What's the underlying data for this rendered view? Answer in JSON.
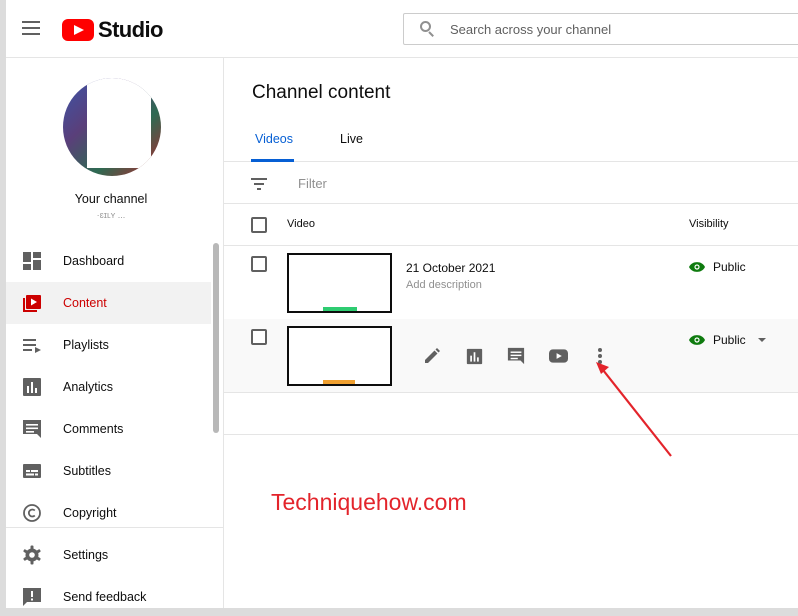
{
  "header": {
    "logo_text": "Studio",
    "search_placeholder": "Search across your channel"
  },
  "sidebar": {
    "channel_label": "Your channel",
    "channel_sub": "·ɛɪʟʏ ...",
    "items": [
      {
        "label": "Dashboard",
        "icon": "dashboard-icon",
        "active": false
      },
      {
        "label": "Content",
        "icon": "content-icon",
        "active": true
      },
      {
        "label": "Playlists",
        "icon": "playlists-icon",
        "active": false
      },
      {
        "label": "Analytics",
        "icon": "analytics-icon",
        "active": false
      },
      {
        "label": "Comments",
        "icon": "comments-icon",
        "active": false
      },
      {
        "label": "Subtitles",
        "icon": "subtitles-icon",
        "active": false
      },
      {
        "label": "Copyright",
        "icon": "copyright-icon",
        "active": false
      }
    ],
    "bottom_items": [
      {
        "label": "Settings",
        "icon": "gear-icon"
      },
      {
        "label": "Send feedback",
        "icon": "feedback-icon"
      }
    ]
  },
  "main": {
    "title": "Channel content",
    "tabs": [
      {
        "label": "Videos",
        "active": true
      },
      {
        "label": "Live",
        "active": false
      }
    ],
    "filter_placeholder": "Filter",
    "columns": [
      "Video",
      "Visibility"
    ],
    "rows": [
      {
        "date": "21 October 2021",
        "description": "Add description",
        "visibility": "Public",
        "thumb_bar_color": "#2ecc71"
      },
      {
        "visibility": "Public",
        "thumb_bar_color": "#f0a030",
        "actions": [
          "pencil-icon",
          "analytics-icon",
          "comments-icon",
          "youtube-icon",
          "more-vert-icon"
        ]
      }
    ]
  },
  "watermark": "Techniquehow.com",
  "colors": {
    "brand_red": "#ff0000",
    "active_red": "#cc0000",
    "tab_blue": "#065fd4",
    "public_green": "#0f7b0f",
    "arrow_red": "#e3242b"
  }
}
